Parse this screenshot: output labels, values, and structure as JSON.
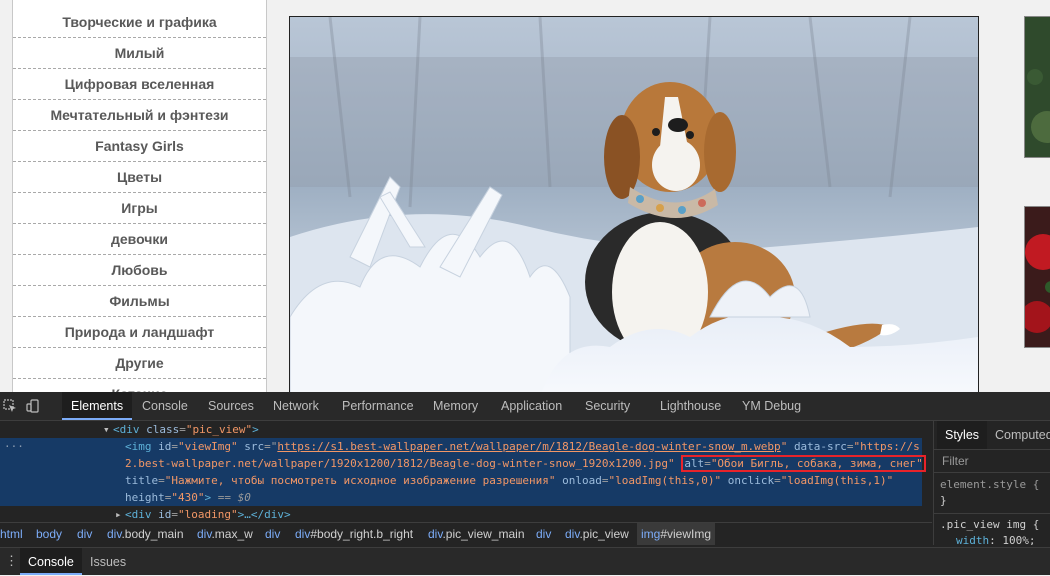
{
  "categories": [
    "Творческие и графика",
    "Милый",
    "Цифровая вселенная",
    "Мечтательный и фэнтези",
    "Fantasy Girls",
    "Цветы",
    "Игры",
    "девочки",
    "Любовь",
    "Фильмы",
    "Природа и ландшафт",
    "Другие",
    "Катание"
  ],
  "devtools": {
    "tabs": [
      "Elements",
      "Console",
      "Sources",
      "Network",
      "Performance",
      "Memory",
      "Application",
      "Security",
      "Lighthouse",
      "YM Debug"
    ],
    "code": {
      "line0": {
        "tag_open": "<div",
        "attr": "class",
        "value": "\"pic_view\"",
        "close": ">"
      },
      "line1": {
        "tag_open": "<img",
        "id_attr": "id",
        "id_val": "\"viewImg\"",
        "src_attr": "src",
        "src_val": "https://s1.best-wallpaper.net/wallpaper/m/1812/Beagle-dog-winter-snow_m.webp",
        "datasrc_attr": "data-src",
        "datasrc_val1": "\"https://s"
      },
      "line2": {
        "datasrc_val2": "2.best-wallpaper.net/wallpaper/1920x1200/1812/Beagle-dog-winter-snow_1920x1200.jpg\"",
        "alt_attr": "alt",
        "alt_val": "\"Обои Бигль, собака, зима, снег\""
      },
      "line3": {
        "title_attr": "title",
        "title_val": "\"Нажмите, чтобы посмотреть исходное изображение разрешения\"",
        "onload_attr": "onload",
        "onload_val": "\"loadImg(this,0)\"",
        "onclick_attr": "onclick",
        "onclick_val": "\"loadImg(this,1)\""
      },
      "line4": {
        "height_attr": "height",
        "height_val": "\"430\"",
        "close": ">",
        "dollar": " == $0"
      },
      "line5": {
        "tag_open": "<div",
        "attr": "id",
        "value": "\"loading\"",
        "rest": ">…</div>"
      }
    },
    "breadcrumbs": [
      {
        "text": "html"
      },
      {
        "text": "body"
      },
      {
        "text": "div"
      },
      {
        "text": "div",
        "cls": ".body_main"
      },
      {
        "text": "div",
        "cls": ".max_w"
      },
      {
        "text": "div"
      },
      {
        "text": "div",
        "cls": "#body_right.b_right"
      },
      {
        "text": "div",
        "cls": ".pic_view_main"
      },
      {
        "text": "div"
      },
      {
        "text": "div",
        "cls": ".pic_view"
      },
      {
        "text": "img",
        "cls": "#viewImg"
      }
    ],
    "styles": {
      "tabs": [
        "Styles",
        "Computed"
      ],
      "filter_placeholder": "Filter",
      "element_style": "element.style {",
      "close_brace": "}",
      "selector": ".pic_view img {",
      "prop": "width",
      "prop_value": ": 100%;"
    },
    "drawer_tabs": [
      "Console",
      "Issues"
    ]
  }
}
